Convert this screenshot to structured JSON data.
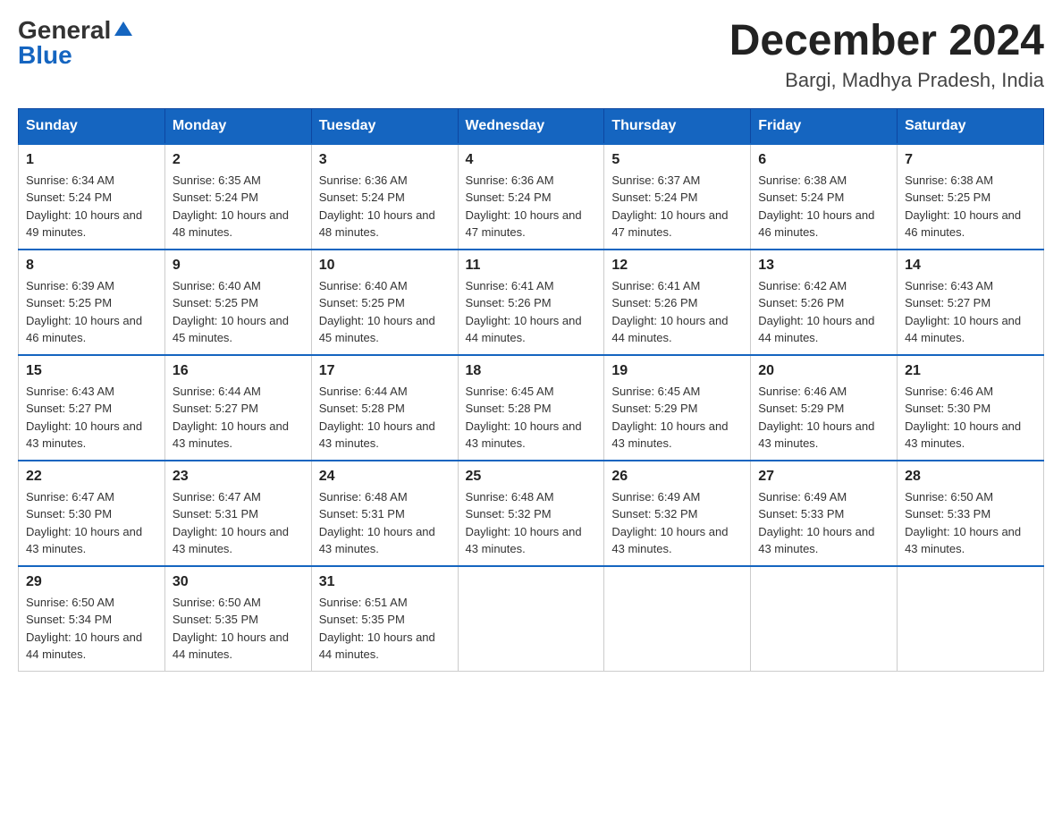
{
  "header": {
    "logo_general": "General",
    "logo_blue": "Blue",
    "title": "December 2024",
    "subtitle": "Bargi, Madhya Pradesh, India"
  },
  "weekdays": [
    "Sunday",
    "Monday",
    "Tuesday",
    "Wednesday",
    "Thursday",
    "Friday",
    "Saturday"
  ],
  "weeks": [
    [
      {
        "day": "1",
        "sunrise": "6:34 AM",
        "sunset": "5:24 PM",
        "daylight": "10 hours and 49 minutes."
      },
      {
        "day": "2",
        "sunrise": "6:35 AM",
        "sunset": "5:24 PM",
        "daylight": "10 hours and 48 minutes."
      },
      {
        "day": "3",
        "sunrise": "6:36 AM",
        "sunset": "5:24 PM",
        "daylight": "10 hours and 48 minutes."
      },
      {
        "day": "4",
        "sunrise": "6:36 AM",
        "sunset": "5:24 PM",
        "daylight": "10 hours and 47 minutes."
      },
      {
        "day": "5",
        "sunrise": "6:37 AM",
        "sunset": "5:24 PM",
        "daylight": "10 hours and 47 minutes."
      },
      {
        "day": "6",
        "sunrise": "6:38 AM",
        "sunset": "5:24 PM",
        "daylight": "10 hours and 46 minutes."
      },
      {
        "day": "7",
        "sunrise": "6:38 AM",
        "sunset": "5:25 PM",
        "daylight": "10 hours and 46 minutes."
      }
    ],
    [
      {
        "day": "8",
        "sunrise": "6:39 AM",
        "sunset": "5:25 PM",
        "daylight": "10 hours and 46 minutes."
      },
      {
        "day": "9",
        "sunrise": "6:40 AM",
        "sunset": "5:25 PM",
        "daylight": "10 hours and 45 minutes."
      },
      {
        "day": "10",
        "sunrise": "6:40 AM",
        "sunset": "5:25 PM",
        "daylight": "10 hours and 45 minutes."
      },
      {
        "day": "11",
        "sunrise": "6:41 AM",
        "sunset": "5:26 PM",
        "daylight": "10 hours and 44 minutes."
      },
      {
        "day": "12",
        "sunrise": "6:41 AM",
        "sunset": "5:26 PM",
        "daylight": "10 hours and 44 minutes."
      },
      {
        "day": "13",
        "sunrise": "6:42 AM",
        "sunset": "5:26 PM",
        "daylight": "10 hours and 44 minutes."
      },
      {
        "day": "14",
        "sunrise": "6:43 AM",
        "sunset": "5:27 PM",
        "daylight": "10 hours and 44 minutes."
      }
    ],
    [
      {
        "day": "15",
        "sunrise": "6:43 AM",
        "sunset": "5:27 PM",
        "daylight": "10 hours and 43 minutes."
      },
      {
        "day": "16",
        "sunrise": "6:44 AM",
        "sunset": "5:27 PM",
        "daylight": "10 hours and 43 minutes."
      },
      {
        "day": "17",
        "sunrise": "6:44 AM",
        "sunset": "5:28 PM",
        "daylight": "10 hours and 43 minutes."
      },
      {
        "day": "18",
        "sunrise": "6:45 AM",
        "sunset": "5:28 PM",
        "daylight": "10 hours and 43 minutes."
      },
      {
        "day": "19",
        "sunrise": "6:45 AM",
        "sunset": "5:29 PM",
        "daylight": "10 hours and 43 minutes."
      },
      {
        "day": "20",
        "sunrise": "6:46 AM",
        "sunset": "5:29 PM",
        "daylight": "10 hours and 43 minutes."
      },
      {
        "day": "21",
        "sunrise": "6:46 AM",
        "sunset": "5:30 PM",
        "daylight": "10 hours and 43 minutes."
      }
    ],
    [
      {
        "day": "22",
        "sunrise": "6:47 AM",
        "sunset": "5:30 PM",
        "daylight": "10 hours and 43 minutes."
      },
      {
        "day": "23",
        "sunrise": "6:47 AM",
        "sunset": "5:31 PM",
        "daylight": "10 hours and 43 minutes."
      },
      {
        "day": "24",
        "sunrise": "6:48 AM",
        "sunset": "5:31 PM",
        "daylight": "10 hours and 43 minutes."
      },
      {
        "day": "25",
        "sunrise": "6:48 AM",
        "sunset": "5:32 PM",
        "daylight": "10 hours and 43 minutes."
      },
      {
        "day": "26",
        "sunrise": "6:49 AM",
        "sunset": "5:32 PM",
        "daylight": "10 hours and 43 minutes."
      },
      {
        "day": "27",
        "sunrise": "6:49 AM",
        "sunset": "5:33 PM",
        "daylight": "10 hours and 43 minutes."
      },
      {
        "day": "28",
        "sunrise": "6:50 AM",
        "sunset": "5:33 PM",
        "daylight": "10 hours and 43 minutes."
      }
    ],
    [
      {
        "day": "29",
        "sunrise": "6:50 AM",
        "sunset": "5:34 PM",
        "daylight": "10 hours and 44 minutes."
      },
      {
        "day": "30",
        "sunrise": "6:50 AM",
        "sunset": "5:35 PM",
        "daylight": "10 hours and 44 minutes."
      },
      {
        "day": "31",
        "sunrise": "6:51 AM",
        "sunset": "5:35 PM",
        "daylight": "10 hours and 44 minutes."
      },
      null,
      null,
      null,
      null
    ]
  ]
}
